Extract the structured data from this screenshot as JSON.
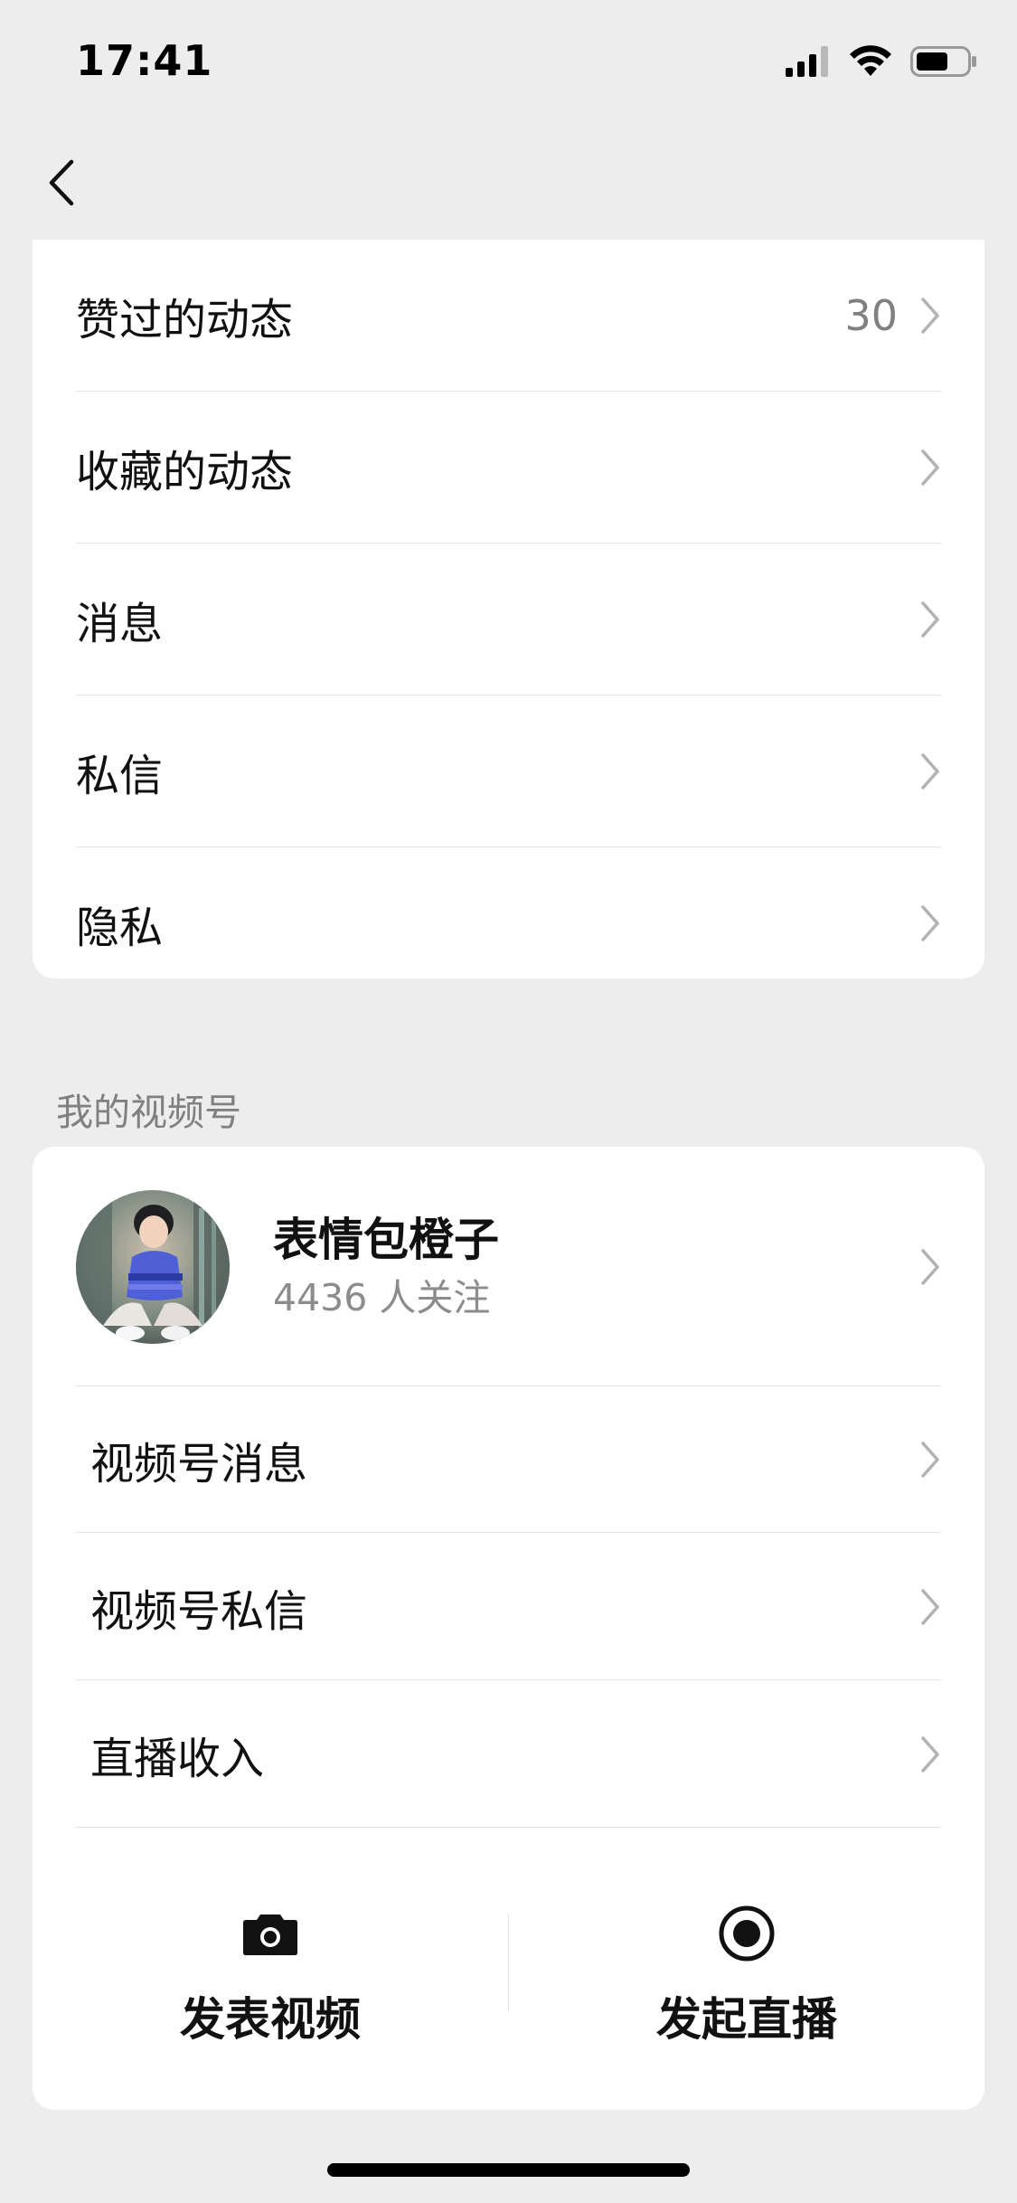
{
  "status_bar": {
    "time": "17:41",
    "icons": [
      "signal-icon",
      "wifi-icon",
      "battery-icon"
    ]
  },
  "nav": {
    "back_icon": "chevron-left-icon"
  },
  "menu": {
    "items": [
      {
        "label": "赞过的动态",
        "count": "30"
      },
      {
        "label": "收藏的动态",
        "count": ""
      },
      {
        "label": "消息",
        "count": ""
      },
      {
        "label": "私信",
        "count": ""
      },
      {
        "label": "隐私",
        "count": ""
      }
    ]
  },
  "channels": {
    "section_title": "我的视频号",
    "profile": {
      "name": "表情包橙子",
      "followers": "4436 人关注"
    },
    "items": [
      {
        "label": "视频号消息"
      },
      {
        "label": "视频号私信"
      },
      {
        "label": "直播收入"
      }
    ],
    "actions": {
      "post_video": {
        "label": "发表视频",
        "icon": "camera-icon"
      },
      "start_live": {
        "label": "发起直播",
        "icon": "live-record-icon"
      }
    }
  }
}
